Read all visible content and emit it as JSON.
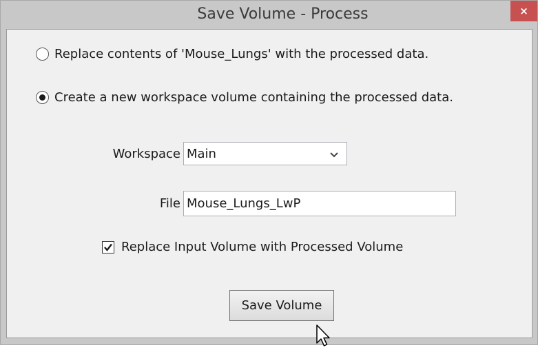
{
  "window": {
    "title": "Save Volume - Process",
    "close_glyph": "×"
  },
  "options": {
    "replace_label": "Replace contents of 'Mouse_Lungs' with the processed data.",
    "replace_selected": false,
    "create_label": "Create a new workspace volume containing the processed data.",
    "create_selected": true
  },
  "form": {
    "workspace_label": "Workspace",
    "workspace_value": "Main",
    "file_label": "File",
    "file_value": "Mouse_Lungs_LwP",
    "replace_input_label": "Replace Input Volume with Processed Volume",
    "replace_input_checked": true
  },
  "actions": {
    "save_label": "Save Volume"
  },
  "icons": {
    "close": "close-icon",
    "radio_selected": "radio-dot-icon",
    "checkmark": "checkmark-icon",
    "dropdown": "chevron-down-icon",
    "cursor": "mouse-pointer-icon"
  },
  "colors": {
    "close_button": "#c75050",
    "title_bar": "#c8c8c8",
    "client_bg": "#f0f0f0"
  }
}
